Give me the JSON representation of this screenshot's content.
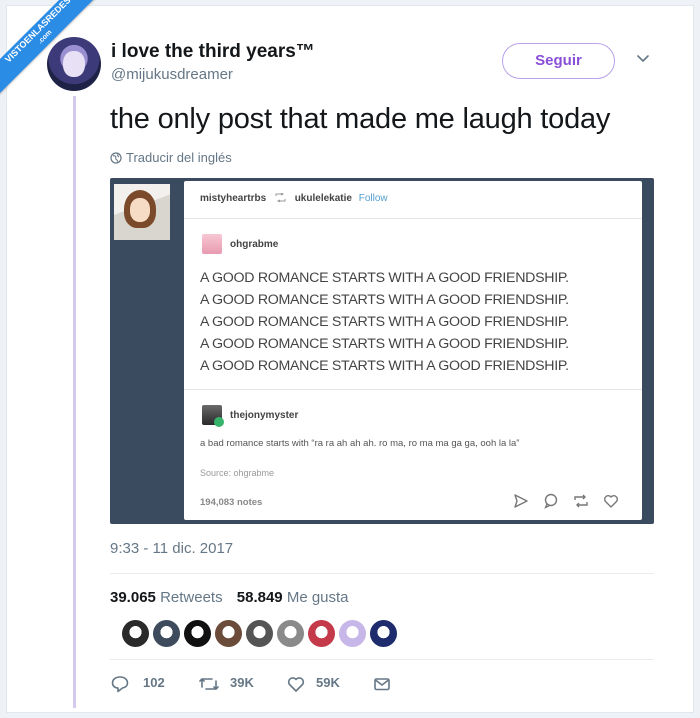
{
  "watermark": {
    "line1": "VISTOENLASREDES",
    "line2": ".com"
  },
  "author": {
    "display_name": "i love the third years™",
    "handle": "@mijukusdreamer"
  },
  "follow_label": "Seguir",
  "tweet": {
    "text": "the only post that made me laugh today",
    "translate": "Traducir del inglés"
  },
  "tumblr": {
    "poster": "mistyheartrbs",
    "reblogged_from": "ukulelekatie",
    "follow_label": "Follow",
    "original_user": "ohgrabme",
    "quote_lines": [
      "A GOOD ROMANCE STARTS WITH A GOOD FRIENDSHIP.",
      "A GOOD ROMANCE STARTS WITH A GOOD FRIENDSHIP.",
      "A GOOD ROMANCE STARTS WITH A GOOD FRIENDSHIP.",
      "A GOOD ROMANCE STARTS WITH A GOOD FRIENDSHIP.",
      "A GOOD ROMANCE STARTS WITH A GOOD FRIENDSHIP."
    ],
    "reply_user": "thejonymyster",
    "reply_text": "a bad romance starts with “ra ra ah ah ah. ro ma, ro ma ma ga ga, ooh la la”",
    "source": "Source:  ohgrabme",
    "notes": "194,083 notes"
  },
  "timestamp": "9:33 - 11 dic. 2017",
  "stats": {
    "retweets_count": "39.065",
    "retweets_label": "Retweets",
    "likes_count": "58.849",
    "likes_label": "Me gusta"
  },
  "liker_avatar_colors": [
    "#2a2a2a",
    "#3d4b5c",
    "#111111",
    "#6b4b3a",
    "#555555",
    "#8a8a8a",
    "#c43a4a",
    "#c7b6e8",
    "#1e2c6e"
  ],
  "actions": {
    "replies": "102",
    "retweets": "39K",
    "likes": "59K"
  },
  "colors": {
    "accent_purple": "#8a4fd8",
    "tumblr_bg": "#3a4b60",
    "tumblr_link": "#529ecc",
    "muted": "#657786"
  }
}
